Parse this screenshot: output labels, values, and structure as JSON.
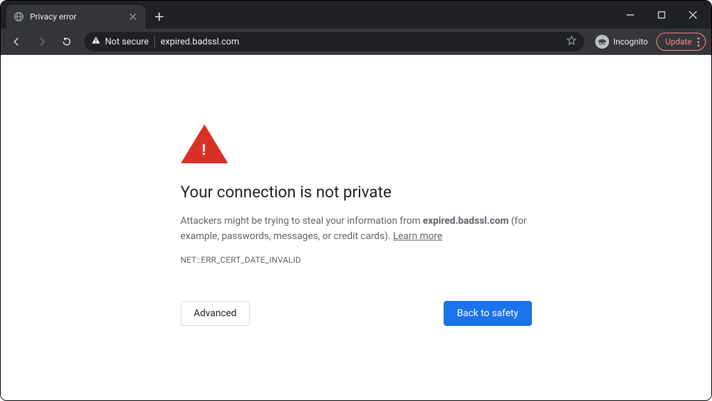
{
  "tab": {
    "title": "Privacy error"
  },
  "toolbar": {
    "security_label": "Not secure",
    "url": "expired.badssl.com",
    "incognito_label": "Incognito",
    "update_label": "Update"
  },
  "interstitial": {
    "headline": "Your connection is not private",
    "body_prefix": "Attackers might be trying to steal your information from ",
    "hostname": "expired.badssl.com",
    "body_suffix": " (for example, passwords, messages, or credit cards). ",
    "learn_more": "Learn more",
    "error_code": "NET::ERR_CERT_DATE_INVALID",
    "advanced_label": "Advanced",
    "back_label": "Back to safety"
  }
}
